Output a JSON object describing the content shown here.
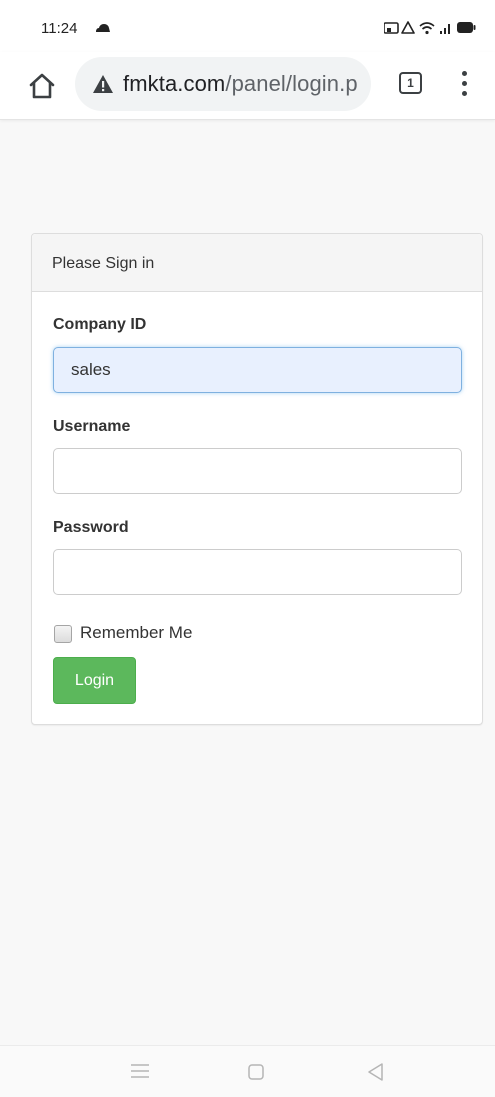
{
  "status_bar": {
    "time": "11:24",
    "icons": [
      "cloud-icon",
      "cast-icon",
      "alarm-icon",
      "wifi-icon",
      "signal-icon",
      "battery-icon"
    ]
  },
  "browser": {
    "url_domain": "fmkta.com",
    "url_path": "/panel/login.p",
    "tab_count": "1",
    "security_icon": "not-secure-warning-icon"
  },
  "login_panel": {
    "heading": "Please Sign in",
    "company_id": {
      "label": "Company ID",
      "value": "sales",
      "placeholder": ""
    },
    "username": {
      "label": "Username",
      "value": "",
      "placeholder": ""
    },
    "password": {
      "label": "Password",
      "value": "",
      "placeholder": ""
    },
    "remember_me": {
      "label": "Remember Me",
      "checked": false
    },
    "login_button": "Login"
  },
  "colors": {
    "login_button": "#5cb85c",
    "focused_input_bg": "#e8f0fe",
    "panel_heading_bg": "#f5f5f5"
  }
}
